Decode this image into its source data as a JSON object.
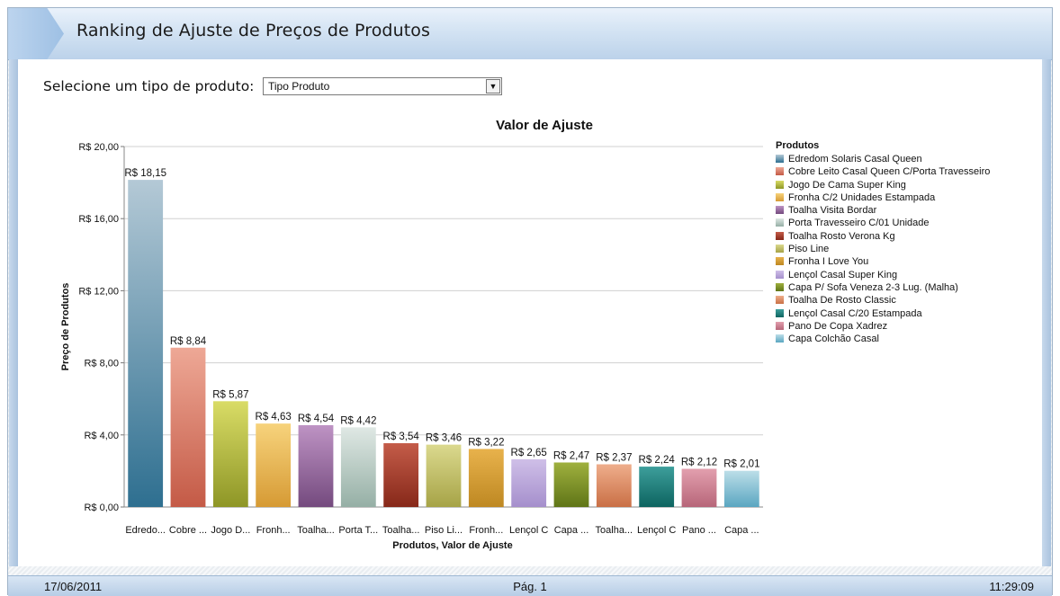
{
  "window": {
    "title": "Ranking de Ajuste de Preços de Produtos"
  },
  "selector": {
    "label": "Selecione um tipo de produto:",
    "value": "Tipo Produto"
  },
  "chart_data": {
    "type": "bar",
    "title": "Valor de Ajuste",
    "xlabel": "Produtos, Valor de Ajuste",
    "ylabel": "Preço de Produtos",
    "ylim": [
      0,
      20
    ],
    "yticks": [
      "R$ 0,00",
      "R$ 4,00",
      "R$ 8,00",
      "R$ 12,00",
      "R$ 16,00",
      "R$ 20,00"
    ],
    "ytick_values": [
      0,
      4,
      8,
      12,
      16,
      20
    ],
    "grid": true,
    "legend_title": "Produtos",
    "legend_position": "right",
    "categories": [
      "Edredom Solaris Casal Queen",
      "Cobre Leito Casal Queen C/Porta Travesseiro",
      "Jogo De Cama Super King",
      "Fronha C/2 Unidades Estampada",
      "Toalha Visita Bordar",
      "Porta Travesseiro C/01 Unidade",
      "Toalha Rosto Verona Kg",
      "Piso Line",
      "Fronha I Love You",
      "Lençol Casal Super King",
      "Capa P/ Sofa Veneza 2-3 Lug. (Malha)",
      "Toalha De Rosto Classic",
      "Lençol Casal C/20 Estampada",
      "Pano De Copa Xadrez",
      "Capa Colchão Casal"
    ],
    "tick_labels": [
      "Edredo...",
      "Cobre ...",
      "Jogo D...",
      "Fronh...",
      "Toalha...",
      "Porta T...",
      "Toalha...",
      "Piso Li...",
      "Fronh...",
      "Lençol C",
      "Capa ...",
      "Toalha...",
      "Lençol C",
      "Pano ...",
      "Capa ..."
    ],
    "values": [
      18.15,
      8.84,
      5.87,
      4.63,
      4.54,
      4.42,
      3.54,
      3.46,
      3.22,
      2.65,
      2.47,
      2.37,
      2.24,
      2.12,
      2.01
    ],
    "value_labels": [
      "R$ 18,15",
      "R$ 8,84",
      "R$ 5,87",
      "R$ 4,63",
      "R$ 4,54",
      "R$ 4,42",
      "R$ 3,54",
      "R$ 3,46",
      "R$ 3,22",
      "R$ 2,65",
      "R$ 2,47",
      "R$ 2,37",
      "R$ 2,24",
      "R$ 2,12",
      "R$ 2,01"
    ],
    "colors": [
      [
        "#b4c9d6",
        "#2e6f90"
      ],
      [
        "#eea896",
        "#c45a46"
      ],
      [
        "#d9dc66",
        "#8e9626"
      ],
      [
        "#f7d37c",
        "#d69a34"
      ],
      [
        "#be93c4",
        "#744a7e"
      ],
      [
        "#dfe8e4",
        "#95afa5"
      ],
      [
        "#c45c49",
        "#862819"
      ],
      [
        "#dbd98e",
        "#a6a346"
      ],
      [
        "#e8b24c",
        "#be8822"
      ],
      [
        "#cfbfe8",
        "#a58fcc"
      ],
      [
        "#9fb03e",
        "#5f7517"
      ],
      [
        "#efae8c",
        "#c96f45"
      ],
      [
        "#3d9e9b",
        "#0d6460"
      ],
      [
        "#e29fae",
        "#b76679"
      ],
      [
        "#bcdee8",
        "#5aa6c1"
      ]
    ]
  },
  "footer": {
    "date": "17/06/2011",
    "page": "Pág. 1",
    "time": "11:29:09"
  }
}
